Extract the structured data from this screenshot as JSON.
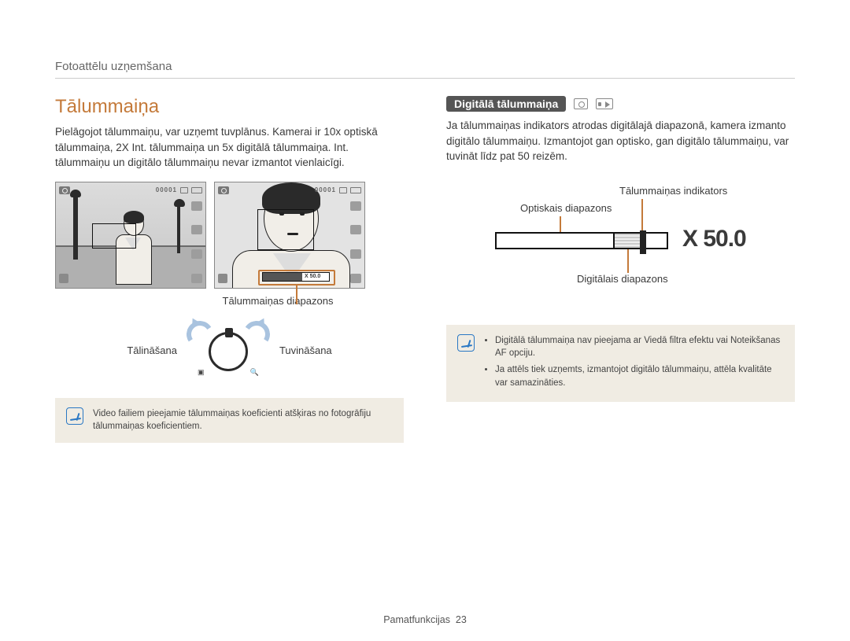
{
  "header": {
    "section": "Fotoattēlu uzņemšana"
  },
  "left": {
    "title": "Tālummaiņa",
    "paragraph": "Pielāgojot tālummaiņu, var uzņemt tuvplānus. Kamerai ir 10x optiskā tālummaiņa, 2X Int. tālummaiņa un 5x digitālā tālummaiņa. Int. tālummaiņu un digitālo tālummaiņu nevar izmantot vienlaicīgi.",
    "preview_counter": "00001",
    "zoom_small_value": "X 50.0",
    "range_label": "Tālummaiņas diapazons",
    "zoom_out_label": "Tālināšana",
    "zoom_in_label": "Tuvināšana",
    "note": "Video failiem pieejamie tālummaiņas koeficienti atšķiras no fotogrāfiju tālummaiņas koeficientiem."
  },
  "right": {
    "subheading": "Digitālā tālummaiņa",
    "paragraph": "Ja tālummaiņas indikators atrodas digitālajā diapazonā, kamera izmanto digitālo tālummaiņu. Izmantojot gan optisko, gan digitālo tālummaiņu, var tuvināt līdz pat 50 reizēm.",
    "labels": {
      "indicator": "Tālummaiņas indikators",
      "optical": "Optiskais diapazons",
      "digital": "Digitālais diapazons"
    },
    "zoom_value": "X 50.0",
    "notes": [
      "Digitālā tālummaiņa nav pieejama ar Viedā filtra efektu vai Noteikšanas AF opciju.",
      "Ja attēls tiek uzņemts, izmantojot digitālo tālummaiņu, attēla kvalitāte var samazināties."
    ]
  },
  "footer": {
    "label": "Pamatfunkcijas",
    "page": "23"
  }
}
